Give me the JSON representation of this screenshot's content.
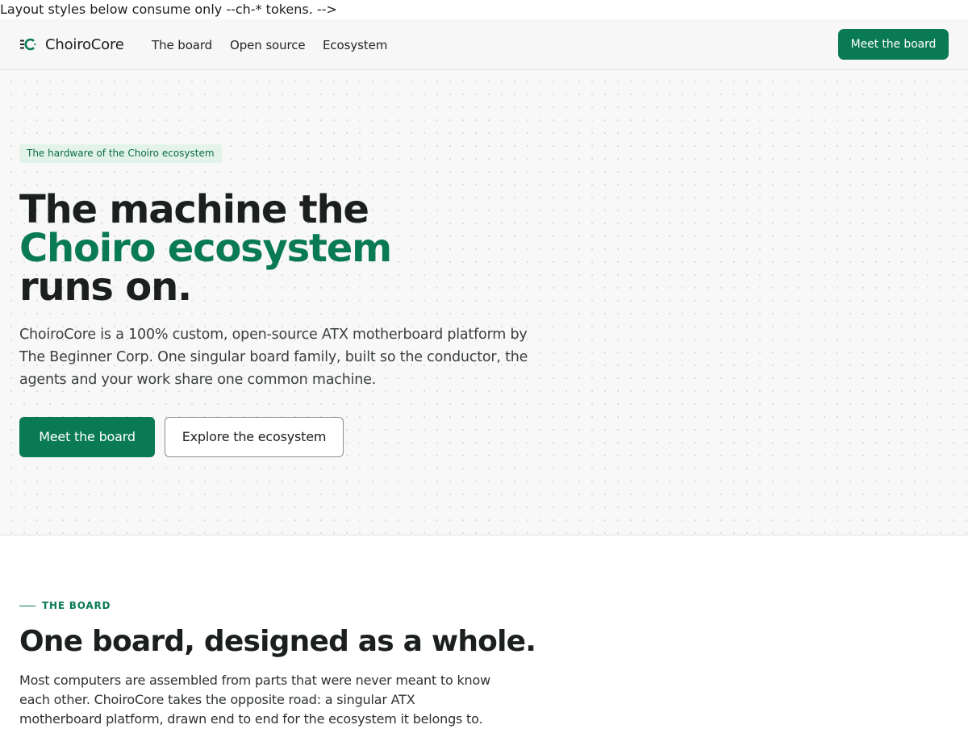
{
  "stray_text": "Layout styles below consume only --ch-* tokens. -->",
  "nav": {
    "logo_icon": "choirocore-logo-icon",
    "brand": "ChoiroCore",
    "links": [
      "The board",
      "Open source",
      "Ecosystem"
    ],
    "cta": "Meet the board"
  },
  "hero": {
    "eyebrow": "The hardware of the Choiro ecosystem",
    "title_line1": "The machine the",
    "title_line2": "Choiro ecosystem",
    "title_line3": "runs on.",
    "subtitle": "ChoiroCore is a 100% custom, open-source ATX motherboard platform by The Beginner Corp. One singular board family, built so the conductor, the agents and your work share one common machine.",
    "primary_button": "Meet the board",
    "secondary_button": "Explore the ecosystem"
  },
  "board_section": {
    "eyebrow": "THE BOARD",
    "title": "One board, designed as a whole.",
    "body": "Most computers are assembled from parts that were never meant to know each other. ChoiroCore takes the opposite road: a singular ATX motherboard platform, drawn end to end for the ecosystem it belongs to."
  },
  "colors": {
    "accent": "#0a7a55",
    "accent_soft": "#e3f3ea",
    "text": "#1b1f1d",
    "hero_background": "#f8f8f8"
  }
}
